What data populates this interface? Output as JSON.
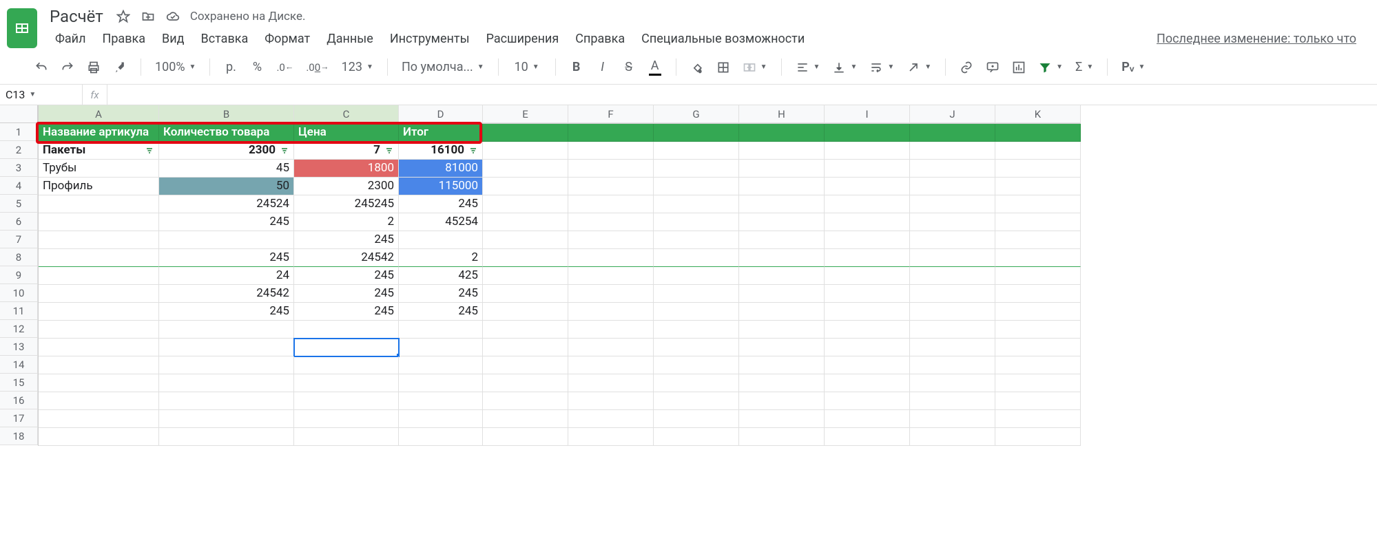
{
  "doc": {
    "title": "Расчёт",
    "saved_text": "Сохранено на Диске.",
    "last_change": "Последнее изменение: только что"
  },
  "menu": {
    "file": "Файл",
    "edit": "Правка",
    "view": "Вид",
    "insert": "Вставка",
    "format": "Формат",
    "data": "Данные",
    "tools": "Инструменты",
    "extensions": "Расширения",
    "help": "Справка",
    "accessibility": "Специальные возможности"
  },
  "toolbar": {
    "zoom": "100%",
    "currency": "р.",
    "percent": "%",
    "dec_dec": ".0",
    "dec_inc": ".00",
    "format123": "123",
    "font": "По умолча...",
    "fontsize": "10",
    "py": "Pᵥ"
  },
  "namebox": {
    "ref": "C13",
    "fx": "fx"
  },
  "columns": [
    "A",
    "B",
    "C",
    "D",
    "E",
    "F",
    "G",
    "H",
    "I",
    "J",
    "K"
  ],
  "row_numbers": [
    "1",
    "2",
    "3",
    "4",
    "5",
    "6",
    "7",
    "8",
    "9",
    "10",
    "11",
    "12",
    "13",
    "14",
    "15",
    "16",
    "17",
    "18"
  ],
  "header_row": {
    "A": "Название артикула",
    "B": "Количество товара",
    "C": "Цена",
    "D": "Итог"
  },
  "rows": [
    {
      "A": "Пакеты",
      "B": "2300",
      "C": "7",
      "D": "16100",
      "bold": true,
      "filter": true
    },
    {
      "A": "Трубы",
      "B": "45",
      "C": "1800",
      "D": "81000",
      "cellC_bg": "orange",
      "cellD_bg": "blue",
      "dark_top": true
    },
    {
      "A": "Профиль",
      "B": "50",
      "C": "2300",
      "D": "115000",
      "cellB_bg": "teal",
      "cellD_bg": "blue"
    },
    {
      "A": "",
      "B": "24524",
      "C": "245245",
      "D": "245"
    },
    {
      "A": "",
      "B": "245",
      "C": "2",
      "D": "45254"
    },
    {
      "A": "",
      "B": "",
      "C": "245",
      "D": ""
    },
    {
      "A": "",
      "B": "245",
      "C": "24542",
      "D": "2",
      "greenline": true
    },
    {
      "A": "",
      "B": "24",
      "C": "245",
      "D": "425"
    },
    {
      "A": "",
      "B": "24542",
      "C": "245",
      "D": "245"
    },
    {
      "A": "",
      "B": "245",
      "C": "245",
      "D": "245"
    }
  ],
  "selected_cell": "C13",
  "red_box_row": 2
}
